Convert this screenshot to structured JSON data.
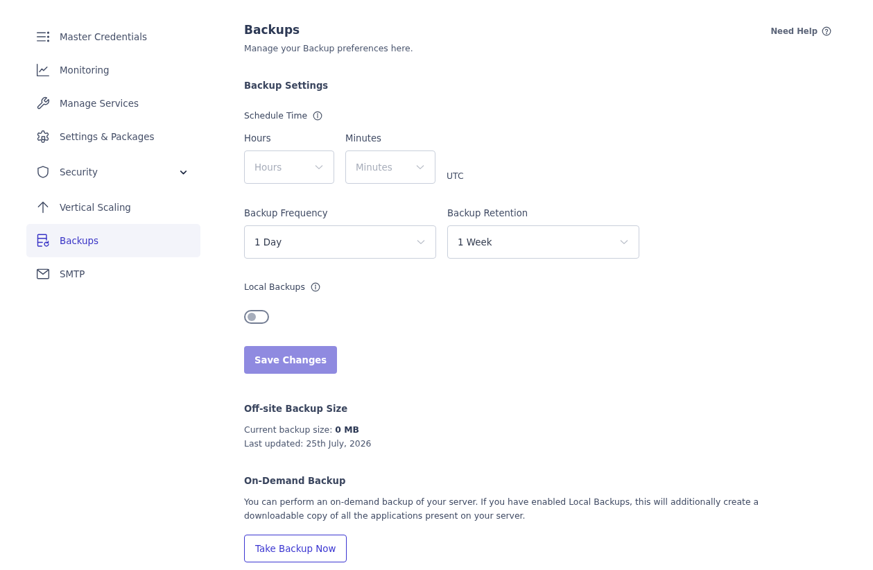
{
  "sidebar": {
    "items": [
      {
        "kind": "credentials",
        "label": "Master Credentials",
        "selected": false
      },
      {
        "kind": "monitoring",
        "label": "Monitoring",
        "selected": false
      },
      {
        "kind": "services",
        "label": "Manage Services",
        "selected": false
      },
      {
        "kind": "settings",
        "label": "Settings & Packages",
        "selected": false
      },
      {
        "kind": "security",
        "label": "Security",
        "selected": false,
        "expanded": false
      },
      {
        "kind": "scaling",
        "label": "Vertical Scaling",
        "selected": false
      },
      {
        "kind": "backups",
        "label": "Backups",
        "selected": true
      },
      {
        "kind": "smtp",
        "label": "SMTP",
        "selected": false
      }
    ]
  },
  "header": {
    "title": "Backups",
    "subtitle": "Manage your Backup preferences here.",
    "help_link": "Need Help"
  },
  "backup_settings": {
    "heading": "Backup Settings",
    "schedule_label": "Schedule Time",
    "time_fields": [
      {
        "label": "Hours",
        "placeholder": "Hours"
      },
      {
        "label": "Minutes",
        "placeholder": "Minutes"
      }
    ],
    "timezone": "UTC",
    "policy_fields": [
      {
        "label": "Backup Frequency",
        "value": "1 Day"
      },
      {
        "label": "Backup Retention",
        "value": "1 Week"
      }
    ],
    "local_backups": {
      "label": "Local Backups",
      "on": false
    },
    "save_button": {
      "label": "Save Changes",
      "disabled": true
    }
  },
  "offsite_backup": {
    "heading": "Off-site Backup Size",
    "size_line": "Current backup size: **0 MB**",
    "updated_line": "Last updated: 25th July, 2026"
  },
  "on_demand_backup": {
    "heading": "On-Demand Backup",
    "description": "You can perform an on-demand backup of your server. If you have enabled Local Backups, this will additionally create a downloadable copy of all the applications present on your server.",
    "button": "Take Backup Now"
  }
}
